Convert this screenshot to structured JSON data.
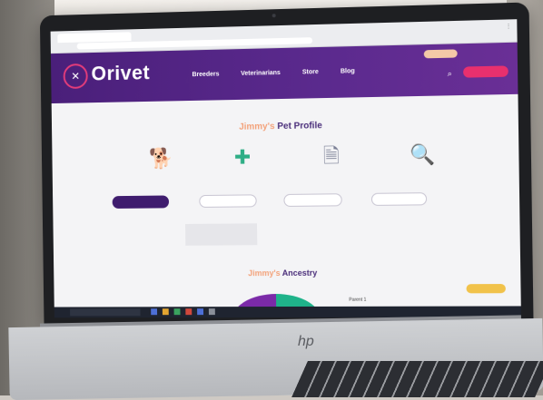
{
  "site": {
    "logo_text": "Orivet",
    "nav": [
      "Breeders",
      "Veterinarians",
      "Store",
      "Blog"
    ]
  },
  "profile": {
    "pet_name": "Jimmy's",
    "title_suffix": "Pet Profile"
  },
  "ancestry": {
    "pet_name": "Jimmy's",
    "title_suffix": "Ancestry",
    "parent_label": "Parent 1"
  },
  "device": {
    "brand_logo": "hp"
  },
  "colors": {
    "header_purple": "#5b2a8e",
    "accent_pink": "#e8306e",
    "accent_peach": "#f3a27a",
    "donut_purple": "#7b2aa8",
    "donut_green": "#1fb38a",
    "gold": "#f1c24a"
  },
  "icons": {
    "dog": "dog-icon",
    "health": "health-cross-icon",
    "document": "document-icon",
    "search": "magnifier-icon"
  }
}
